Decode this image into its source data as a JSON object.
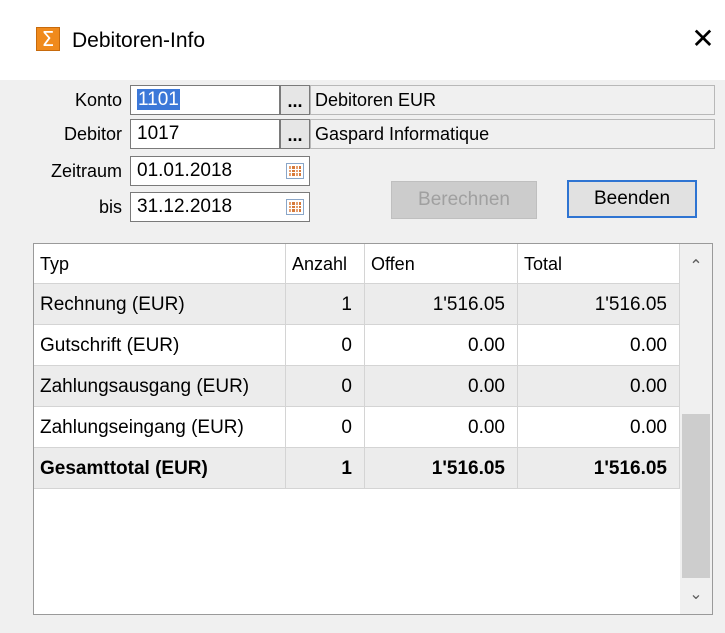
{
  "window": {
    "title": "Debitoren-Info",
    "close_glyph": "✕",
    "icon_glyph": "Σ"
  },
  "form": {
    "konto": {
      "label": "Konto",
      "value": "1101",
      "lookup": "...",
      "description": "Debitoren EUR"
    },
    "debitor": {
      "label": "Debitor",
      "value": "1017",
      "lookup": "...",
      "description": "Gaspard Informatique"
    },
    "zeitraum": {
      "label": "Zeitraum",
      "value": "01.01.2018"
    },
    "bis": {
      "label": "bis",
      "value": "31.12.2018"
    }
  },
  "buttons": {
    "berechnen": "Berechnen",
    "beenden": "Beenden"
  },
  "table": {
    "columns": [
      "Typ",
      "Anzahl",
      "Offen",
      "Total"
    ],
    "rows": [
      {
        "typ": "Rechnung (EUR)",
        "anzahl": "1",
        "offen": "1'516.05",
        "total": "1'516.05"
      },
      {
        "typ": "Gutschrift (EUR)",
        "anzahl": "0",
        "offen": "0.00",
        "total": "0.00"
      },
      {
        "typ": "Zahlungsausgang (EUR)",
        "anzahl": "0",
        "offen": "0.00",
        "total": "0.00"
      },
      {
        "typ": "Zahlungseingang (EUR)",
        "anzahl": "0",
        "offen": "0.00",
        "total": "0.00"
      },
      {
        "typ": "Gesamttotal (EUR)",
        "anzahl": "1",
        "offen": "1'516.05",
        "total": "1'516.05"
      }
    ]
  },
  "scrollbar": {
    "up": "⌃",
    "down": "⌄"
  },
  "colors": {
    "selection": "#3c78d8",
    "default_button_border": "#2e74d2",
    "app_icon": "#f08a1c"
  }
}
